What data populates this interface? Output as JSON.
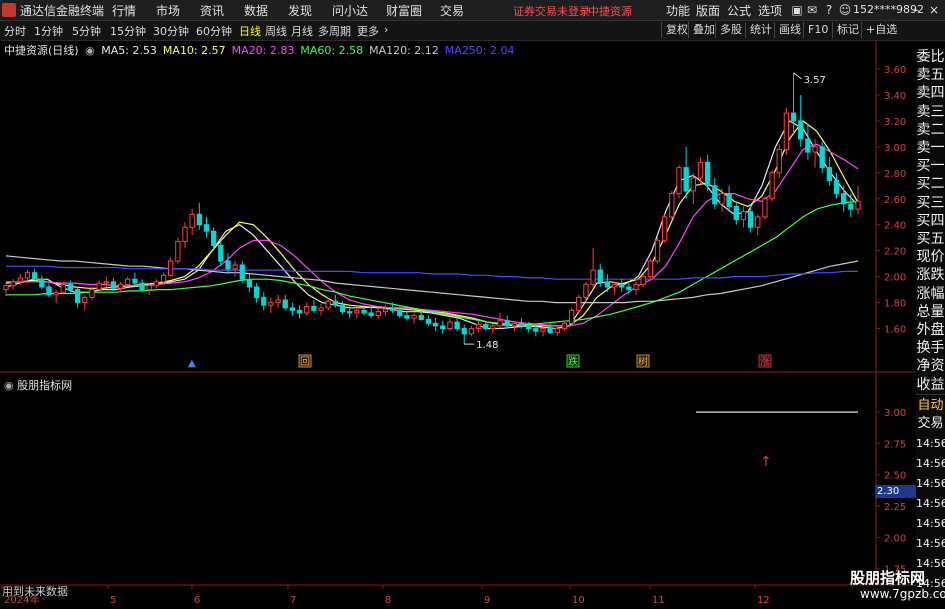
{
  "app": {
    "title": "通达信金融终端",
    "menus": [
      "行情",
      "市场",
      "资讯",
      "数据",
      "发现",
      "问小达",
      "财富圈",
      "交易"
    ],
    "notice_left": "证券交易未登录",
    "notice_right": "中捷资源",
    "right_menus": [
      "功能",
      "版面",
      "公式",
      "选项"
    ],
    "account": "152****9892"
  },
  "periods": {
    "items": [
      "分时",
      "1分钟",
      "5分钟",
      "15分钟",
      "30分钟",
      "60分钟",
      "日线",
      "周线",
      "月线",
      "多周期",
      "更多"
    ],
    "active_index": 6
  },
  "toolbar": {
    "buttons": [
      "复权",
      "叠加",
      "多股",
      "统计",
      "画线",
      "F10",
      "标记",
      "+自选"
    ]
  },
  "main_chart": {
    "stock_label": "中捷资源(日线)",
    "ma_legend": [
      {
        "name": "MA5",
        "value": "2.53",
        "color": "#e8e8e8"
      },
      {
        "name": "MA10",
        "value": "2.57",
        "color": "#ffff55"
      },
      {
        "name": "MA20",
        "value": "2.83",
        "color": "#ff44ff"
      },
      {
        "name": "MA60",
        "value": "2.58",
        "color": "#44ff44"
      },
      {
        "name": "MA120",
        "value": "2.12",
        "color": "#c8c8c8"
      },
      {
        "name": "MA250",
        "value": "2.04",
        "color": "#4a4aff"
      }
    ],
    "high_label": "3.57",
    "low_label": "1.48",
    "event_markers": [
      {
        "label": "回",
        "color": "#ffaa33"
      },
      {
        "label": "跌",
        "color": "#33ff33"
      },
      {
        "label": "树",
        "color": "#ffaa33"
      },
      {
        "label": "涨",
        "color": "#ff3333"
      }
    ]
  },
  "sub_chart": {
    "title": "股朋指标网",
    "value_badge": "2.30"
  },
  "right_panel": {
    "items": [
      "委比",
      "卖五",
      "卖四",
      "卖三",
      "卖二",
      "卖一",
      "买一",
      "买二",
      "买三",
      "买四",
      "买五",
      "现价",
      "涨跌",
      "涨幅",
      "总量",
      "外盘",
      "换手",
      "净资",
      "收益"
    ],
    "trade_tab": "自动",
    "trade_label": "交易",
    "time_rows": [
      "14:56",
      "14:56",
      "14:56",
      "14:56",
      "14:56",
      "14:56",
      "14:56",
      "14:56"
    ]
  },
  "x_axis": {
    "labels": [
      "2024年",
      "5",
      "6",
      "7",
      "8",
      "9",
      "10",
      "11",
      "12"
    ]
  },
  "footer": {
    "text": "用到未来数据",
    "watermark": "股朋指标网",
    "watermark_url": "www.7gpzb.com"
  },
  "chart_data": {
    "type": "candlestick",
    "ylim": [
      1.45,
      3.7
    ],
    "yticks": [
      1.6,
      1.8,
      2.0,
      2.2,
      2.4,
      2.6,
      2.8,
      3.0,
      3.2,
      3.4,
      3.6
    ],
    "sub_ylim": [
      1.7,
      3.2
    ],
    "sub_yticks": [
      3.0,
      2.75,
      2.5,
      2.25,
      2.0,
      1.75
    ],
    "sub_series": [
      {
        "values": [
          3.0,
          3.0
        ]
      }
    ],
    "candles": [
      [
        1.9,
        1.95,
        1.85,
        1.93
      ],
      [
        1.93,
        1.98,
        1.9,
        1.96
      ],
      [
        1.96,
        2.02,
        1.94,
        1.99
      ],
      [
        1.99,
        2.05,
        1.95,
        2.03
      ],
      [
        2.03,
        2.06,
        1.97,
        1.98
      ],
      [
        1.98,
        2.01,
        1.9,
        1.92
      ],
      [
        1.92,
        1.95,
        1.84,
        1.86
      ],
      [
        1.86,
        1.9,
        1.8,
        1.88
      ],
      [
        1.88,
        1.96,
        1.86,
        1.94
      ],
      [
        1.94,
        1.97,
        1.88,
        1.9
      ],
      [
        1.9,
        1.92,
        1.76,
        1.8
      ],
      [
        1.8,
        1.86,
        1.74,
        1.84
      ],
      [
        1.84,
        1.92,
        1.82,
        1.9
      ],
      [
        1.9,
        1.97,
        1.88,
        1.95
      ],
      [
        1.95,
        2.0,
        1.92,
        1.96
      ],
      [
        1.96,
        1.99,
        1.89,
        1.91
      ],
      [
        1.91,
        1.96,
        1.88,
        1.94
      ],
      [
        1.94,
        2.0,
        1.93,
        1.98
      ],
      [
        1.98,
        2.03,
        1.94,
        1.95
      ],
      [
        1.95,
        1.98,
        1.88,
        1.9
      ],
      [
        1.9,
        1.95,
        1.86,
        1.93
      ],
      [
        1.93,
        1.98,
        1.91,
        1.96
      ],
      [
        1.96,
        2.03,
        1.95,
        2.01
      ],
      [
        2.01,
        2.15,
        2.0,
        2.12
      ],
      [
        2.12,
        2.3,
        2.1,
        2.27
      ],
      [
        2.27,
        2.42,
        2.22,
        2.38
      ],
      [
        2.38,
        2.52,
        2.32,
        2.48
      ],
      [
        2.48,
        2.57,
        2.36,
        2.4
      ],
      [
        2.4,
        2.46,
        2.3,
        2.35
      ],
      [
        2.35,
        2.38,
        2.2,
        2.24
      ],
      [
        2.24,
        2.28,
        2.08,
        2.12
      ],
      [
        2.12,
        2.18,
        2.02,
        2.06
      ],
      [
        2.06,
        2.12,
        2.0,
        2.09
      ],
      [
        2.09,
        2.12,
        1.95,
        1.98
      ],
      [
        1.98,
        2.02,
        1.88,
        1.92
      ],
      [
        1.92,
        1.95,
        1.8,
        1.84
      ],
      [
        1.84,
        1.88,
        1.74,
        1.78
      ],
      [
        1.78,
        1.84,
        1.72,
        1.8
      ],
      [
        1.8,
        1.86,
        1.76,
        1.82
      ],
      [
        1.82,
        1.86,
        1.74,
        1.76
      ],
      [
        1.76,
        1.8,
        1.7,
        1.74
      ],
      [
        1.74,
        1.78,
        1.68,
        1.72
      ],
      [
        1.72,
        1.8,
        1.7,
        1.77
      ],
      [
        1.77,
        1.82,
        1.72,
        1.74
      ],
      [
        1.74,
        1.79,
        1.7,
        1.76
      ],
      [
        1.76,
        1.84,
        1.74,
        1.81
      ],
      [
        1.81,
        1.86,
        1.76,
        1.78
      ],
      [
        1.78,
        1.81,
        1.71,
        1.73
      ],
      [
        1.73,
        1.77,
        1.68,
        1.72
      ],
      [
        1.72,
        1.76,
        1.68,
        1.74
      ],
      [
        1.74,
        1.78,
        1.7,
        1.72
      ],
      [
        1.72,
        1.76,
        1.68,
        1.7
      ],
      [
        1.7,
        1.75,
        1.67,
        1.73
      ],
      [
        1.73,
        1.78,
        1.7,
        1.75
      ],
      [
        1.75,
        1.8,
        1.72,
        1.74
      ],
      [
        1.74,
        1.77,
        1.68,
        1.7
      ],
      [
        1.7,
        1.74,
        1.66,
        1.68
      ],
      [
        1.68,
        1.72,
        1.64,
        1.7
      ],
      [
        1.7,
        1.74,
        1.66,
        1.67
      ],
      [
        1.67,
        1.7,
        1.62,
        1.64
      ],
      [
        1.64,
        1.68,
        1.58,
        1.62
      ],
      [
        1.62,
        1.66,
        1.56,
        1.6
      ],
      [
        1.6,
        1.68,
        1.58,
        1.65
      ],
      [
        1.65,
        1.68,
        1.58,
        1.6
      ],
      [
        1.6,
        1.63,
        1.48,
        1.56
      ],
      [
        1.56,
        1.62,
        1.54,
        1.6
      ],
      [
        1.6,
        1.66,
        1.57,
        1.63
      ],
      [
        1.63,
        1.66,
        1.58,
        1.6
      ],
      [
        1.6,
        1.64,
        1.56,
        1.62
      ],
      [
        1.62,
        1.72,
        1.6,
        1.66
      ],
      [
        1.66,
        1.7,
        1.6,
        1.62
      ],
      [
        1.62,
        1.66,
        1.58,
        1.64
      ],
      [
        1.64,
        1.68,
        1.6,
        1.62
      ],
      [
        1.62,
        1.65,
        1.57,
        1.6
      ],
      [
        1.6,
        1.63,
        1.54,
        1.58
      ],
      [
        1.58,
        1.62,
        1.54,
        1.6
      ],
      [
        1.6,
        1.64,
        1.56,
        1.57
      ],
      [
        1.57,
        1.62,
        1.54,
        1.6
      ],
      [
        1.6,
        1.66,
        1.58,
        1.64
      ],
      [
        1.64,
        1.76,
        1.62,
        1.74
      ],
      [
        1.74,
        1.86,
        1.72,
        1.84
      ],
      [
        1.84,
        1.96,
        1.8,
        1.94
      ],
      [
        1.94,
        2.22,
        1.92,
        2.05
      ],
      [
        2.05,
        2.1,
        1.92,
        1.96
      ],
      [
        1.96,
        2.02,
        1.88,
        1.92
      ],
      [
        1.92,
        1.96,
        1.86,
        1.94
      ],
      [
        1.94,
        1.98,
        1.88,
        1.92
      ],
      [
        1.92,
        1.95,
        1.86,
        1.9
      ],
      [
        1.9,
        1.96,
        1.86,
        1.94
      ],
      [
        1.94,
        2.02,
        1.92,
        2.0
      ],
      [
        2.0,
        2.14,
        1.98,
        2.12
      ],
      [
        2.12,
        2.3,
        2.1,
        2.28
      ],
      [
        2.28,
        2.48,
        2.26,
        2.46
      ],
      [
        2.46,
        2.66,
        2.44,
        2.64
      ],
      [
        2.64,
        2.86,
        2.6,
        2.84
      ],
      [
        2.84,
        3.0,
        2.6,
        2.66
      ],
      [
        2.66,
        2.8,
        2.56,
        2.76
      ],
      [
        2.76,
        2.92,
        2.7,
        2.88
      ],
      [
        2.88,
        2.94,
        2.66,
        2.7
      ],
      [
        2.7,
        2.76,
        2.52,
        2.56
      ],
      [
        2.56,
        2.68,
        2.5,
        2.64
      ],
      [
        2.64,
        2.7,
        2.5,
        2.54
      ],
      [
        2.54,
        2.58,
        2.4,
        2.44
      ],
      [
        2.44,
        2.54,
        2.38,
        2.5
      ],
      [
        2.5,
        2.56,
        2.34,
        2.38
      ],
      [
        2.38,
        2.48,
        2.32,
        2.46
      ],
      [
        2.46,
        2.62,
        2.44,
        2.6
      ],
      [
        2.6,
        2.82,
        2.58,
        2.8
      ],
      [
        2.8,
        3.02,
        2.76,
        2.98
      ],
      [
        2.98,
        3.3,
        2.94,
        3.26
      ],
      [
        3.26,
        3.57,
        3.1,
        3.2
      ],
      [
        3.2,
        3.4,
        3.0,
        3.06
      ],
      [
        3.06,
        3.18,
        2.9,
        2.96
      ],
      [
        2.96,
        3.06,
        2.84,
        3.0
      ],
      [
        3.0,
        3.04,
        2.8,
        2.84
      ],
      [
        2.84,
        2.92,
        2.7,
        2.74
      ],
      [
        2.74,
        2.8,
        2.6,
        2.64
      ],
      [
        2.64,
        2.7,
        2.5,
        2.56
      ],
      [
        2.56,
        2.64,
        2.46,
        2.52
      ],
      [
        2.52,
        2.7,
        2.48,
        2.58
      ]
    ],
    "ma": {
      "MA5": [
        1.92,
        1.95,
        1.98,
        1.98,
        1.92,
        1.88,
        1.88,
        1.9,
        1.9,
        1.92,
        1.93,
        1.94,
        1.96,
        1.98,
        2.05,
        2.2,
        2.35,
        2.4,
        2.32,
        2.2,
        2.08,
        1.96,
        1.86,
        1.8,
        1.78,
        1.76,
        1.76,
        1.77,
        1.75,
        1.73,
        1.73,
        1.72,
        1.7,
        1.68,
        1.64,
        1.6,
        1.6,
        1.61,
        1.62,
        1.61,
        1.6,
        1.62,
        1.78,
        1.95,
        1.96,
        1.94,
        2.0,
        2.2,
        2.5,
        2.74,
        2.78,
        2.7,
        2.56,
        2.48,
        2.5,
        2.7,
        3.0,
        3.2,
        3.14,
        2.96,
        2.8,
        2.66,
        2.55
      ],
      "MA10": [
        1.95,
        1.96,
        1.97,
        1.96,
        1.94,
        1.92,
        1.91,
        1.91,
        1.92,
        1.93,
        1.94,
        1.95,
        1.97,
        2.0,
        2.08,
        2.2,
        2.32,
        2.42,
        2.4,
        2.3,
        2.18,
        2.05,
        1.94,
        1.86,
        1.8,
        1.78,
        1.77,
        1.76,
        1.76,
        1.75,
        1.74,
        1.73,
        1.72,
        1.7,
        1.68,
        1.65,
        1.63,
        1.62,
        1.62,
        1.62,
        1.62,
        1.62,
        1.7,
        1.84,
        1.92,
        1.95,
        1.98,
        2.1,
        2.32,
        2.56,
        2.7,
        2.72,
        2.66,
        2.58,
        2.54,
        2.62,
        2.82,
        3.06,
        3.2,
        3.12,
        2.96,
        2.76,
        2.57
      ],
      "MA20": [
        1.96,
        1.96,
        1.96,
        1.96,
        1.95,
        1.95,
        1.94,
        1.94,
        1.93,
        1.93,
        1.93,
        1.94,
        1.95,
        1.96,
        1.99,
        2.04,
        2.12,
        2.22,
        2.28,
        2.28,
        2.24,
        2.16,
        2.06,
        1.96,
        1.88,
        1.82,
        1.79,
        1.77,
        1.76,
        1.76,
        1.75,
        1.74,
        1.73,
        1.72,
        1.71,
        1.69,
        1.67,
        1.65,
        1.64,
        1.63,
        1.62,
        1.62,
        1.64,
        1.7,
        1.78,
        1.86,
        1.93,
        1.98,
        2.08,
        2.26,
        2.46,
        2.58,
        2.64,
        2.64,
        2.6,
        2.58,
        2.66,
        2.82,
        2.98,
        3.02,
        2.96,
        2.9,
        2.83
      ],
      "MA60": [
        1.86,
        1.86,
        1.86,
        1.87,
        1.87,
        1.87,
        1.88,
        1.88,
        1.88,
        1.89,
        1.89,
        1.9,
        1.9,
        1.91,
        1.92,
        1.93,
        1.95,
        1.97,
        1.98,
        1.98,
        1.97,
        1.95,
        1.93,
        1.9,
        1.88,
        1.85,
        1.83,
        1.81,
        1.79,
        1.77,
        1.75,
        1.73,
        1.71,
        1.69,
        1.67,
        1.65,
        1.64,
        1.63,
        1.63,
        1.64,
        1.65,
        1.66,
        1.67,
        1.69,
        1.71,
        1.74,
        1.77,
        1.8,
        1.84,
        1.88,
        1.94,
        2.0,
        2.06,
        2.12,
        2.18,
        2.24,
        2.3,
        2.38,
        2.46,
        2.52,
        2.55,
        2.57,
        2.58
      ],
      "MA120": [
        2.16,
        2.15,
        2.14,
        2.13,
        2.12,
        2.12,
        2.11,
        2.1,
        2.09,
        2.08,
        2.08,
        2.07,
        2.06,
        2.06,
        2.05,
        2.04,
        2.03,
        2.03,
        2.02,
        2.01,
        2.0,
        1.99,
        1.98,
        1.97,
        1.95,
        1.94,
        1.93,
        1.92,
        1.91,
        1.9,
        1.89,
        1.88,
        1.87,
        1.86,
        1.85,
        1.84,
        1.83,
        1.82,
        1.81,
        1.81,
        1.8,
        1.8,
        1.8,
        1.8,
        1.8,
        1.8,
        1.81,
        1.81,
        1.82,
        1.83,
        1.84,
        1.86,
        1.87,
        1.89,
        1.91,
        1.93,
        1.96,
        1.99,
        2.02,
        2.05,
        2.08,
        2.1,
        2.12
      ],
      "MA250": [
        2.08,
        2.08,
        2.08,
        2.08,
        2.07,
        2.07,
        2.07,
        2.07,
        2.07,
        2.06,
        2.06,
        2.06,
        2.06,
        2.06,
        2.06,
        2.05,
        2.05,
        2.05,
        2.05,
        2.05,
        2.05,
        2.04,
        2.04,
        2.04,
        2.04,
        2.04,
        2.03,
        2.03,
        2.03,
        2.03,
        2.03,
        2.02,
        2.02,
        2.02,
        2.01,
        2.01,
        2.0,
        2.0,
        1.99,
        1.99,
        1.98,
        1.98,
        1.98,
        1.98,
        1.98,
        1.98,
        1.98,
        1.98,
        1.98,
        1.98,
        1.99,
        1.99,
        1.99,
        2.0,
        2.0,
        2.0,
        2.01,
        2.02,
        2.02,
        2.03,
        2.03,
        2.04,
        2.04
      ]
    }
  }
}
